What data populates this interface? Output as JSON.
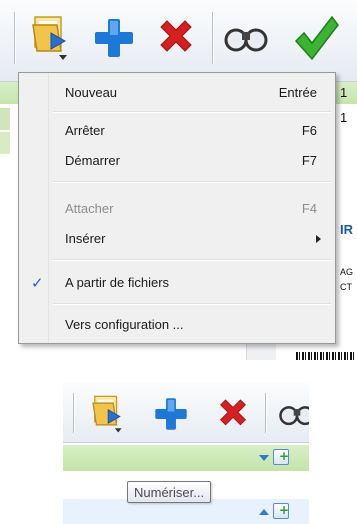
{
  "menu": {
    "items": [
      {
        "label": "Nouveau",
        "shortcut": "Entrée",
        "enabled": true
      },
      {
        "label": "Arrêter",
        "shortcut": "F6",
        "enabled": true
      },
      {
        "label": "Démarrer",
        "shortcut": "F7",
        "enabled": true
      },
      {
        "label": "Attacher",
        "shortcut": "F4",
        "enabled": false
      },
      {
        "label": "Insérer",
        "shortcut": "",
        "enabled": true,
        "submenu": true
      },
      {
        "label": "A partir de fichiers",
        "shortcut": "",
        "enabled": true,
        "checked": true
      },
      {
        "label": "Vers configuration ...",
        "shortcut": "",
        "enabled": true
      }
    ]
  },
  "background": {
    "row1_value": "1",
    "row2_value": "1",
    "side_text_1": "IR",
    "side_text_2": "AG",
    "side_text_3": "CT"
  },
  "tooltip": {
    "text": "Numériser..."
  },
  "colors": {
    "add_icon": "#1e78d6",
    "delete_icon": "#d42020",
    "validate_icon": "#3bb531",
    "check_mark": "#1e63c6",
    "green_row": "#cfe8b8"
  },
  "icons": [
    "open-folder-icon",
    "add-icon",
    "delete-icon",
    "binoculars-icon",
    "validate-icon"
  ]
}
